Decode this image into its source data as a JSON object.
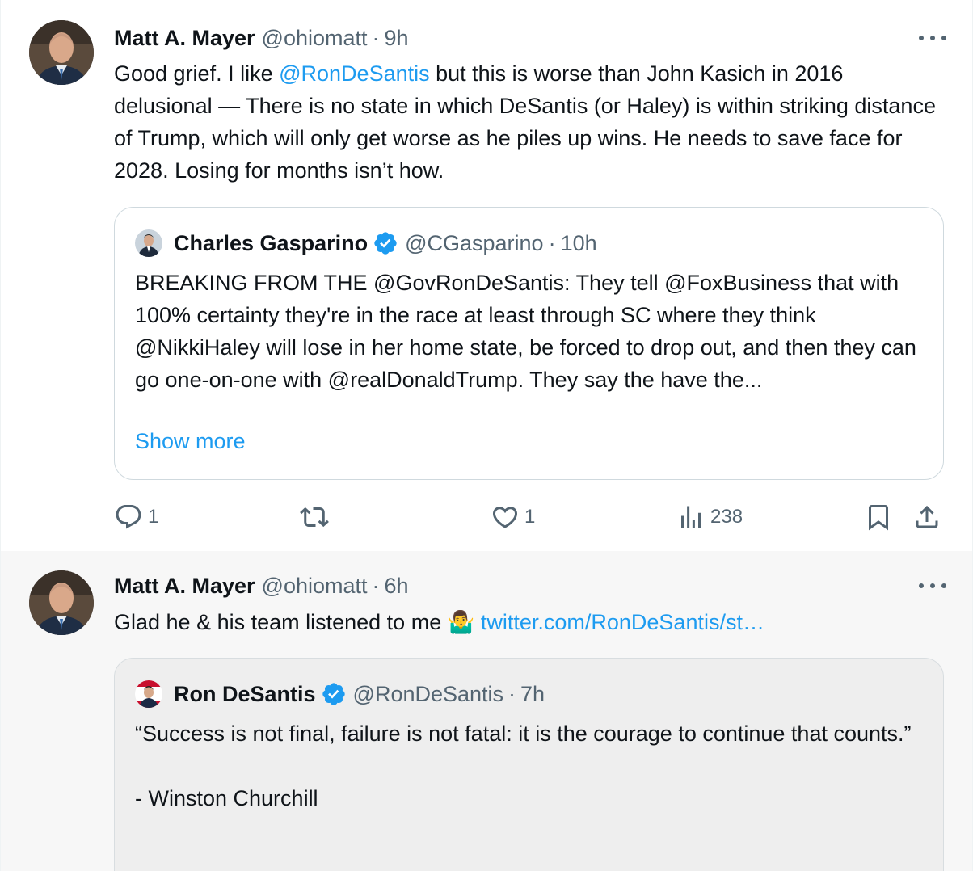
{
  "tweet1": {
    "name": "Matt A. Mayer",
    "handle": "@ohiomatt",
    "separator": "·",
    "time": "9h",
    "text_before": "Good grief. I like ",
    "mention": "@RonDeSantis",
    "text_after": " but this is worse than John Kasich in 2016 delusional — There is no state in which DeSantis (or Haley) is within striking distance of Trump, which will only get worse as he piles up wins. He needs to save face for 2028. Losing for months isn’t how.",
    "quote": {
      "name": "Charles Gasparino",
      "handle": "@CGasparino",
      "separator": "·",
      "time": "10h",
      "text": "BREAKING FROM THE @GovRonDeSantis: They tell @FoxBusiness that with 100% certainty they're in the race at least through SC where they think @NikkiHaley will lose in her home state, be forced to drop out, and then they can go one-on-one with @realDonaldTrump. They say the have the...",
      "show_more": "Show more"
    },
    "actions": {
      "replies": "1",
      "retweets": "",
      "likes": "1",
      "views": "238"
    }
  },
  "tweet2": {
    "name": "Matt A. Mayer",
    "handle": "@ohiomatt",
    "separator": "·",
    "time": "6h",
    "text": "Glad he & his team listened to me 🤷‍♂️ ",
    "link": "twitter.com/RonDeSantis/st…",
    "quote": {
      "name": "Ron DeSantis",
      "handle": "@RonDeSantis",
      "separator": "·",
      "time": "7h",
      "text_line1": "“Success is not final, failure is not fatal: it is the courage to continue that counts.”",
      "text_line2": "- Winston Churchill"
    }
  },
  "colors": {
    "link": "#1d9bf0",
    "secondary_text": "#536471",
    "verified": "#1d9bf0",
    "thread_line": "#cfd9de"
  },
  "icons": [
    "more-icon",
    "reply-icon",
    "retweet-icon",
    "like-icon",
    "views-icon",
    "bookmark-icon",
    "share-icon",
    "verified-badge-icon"
  ]
}
